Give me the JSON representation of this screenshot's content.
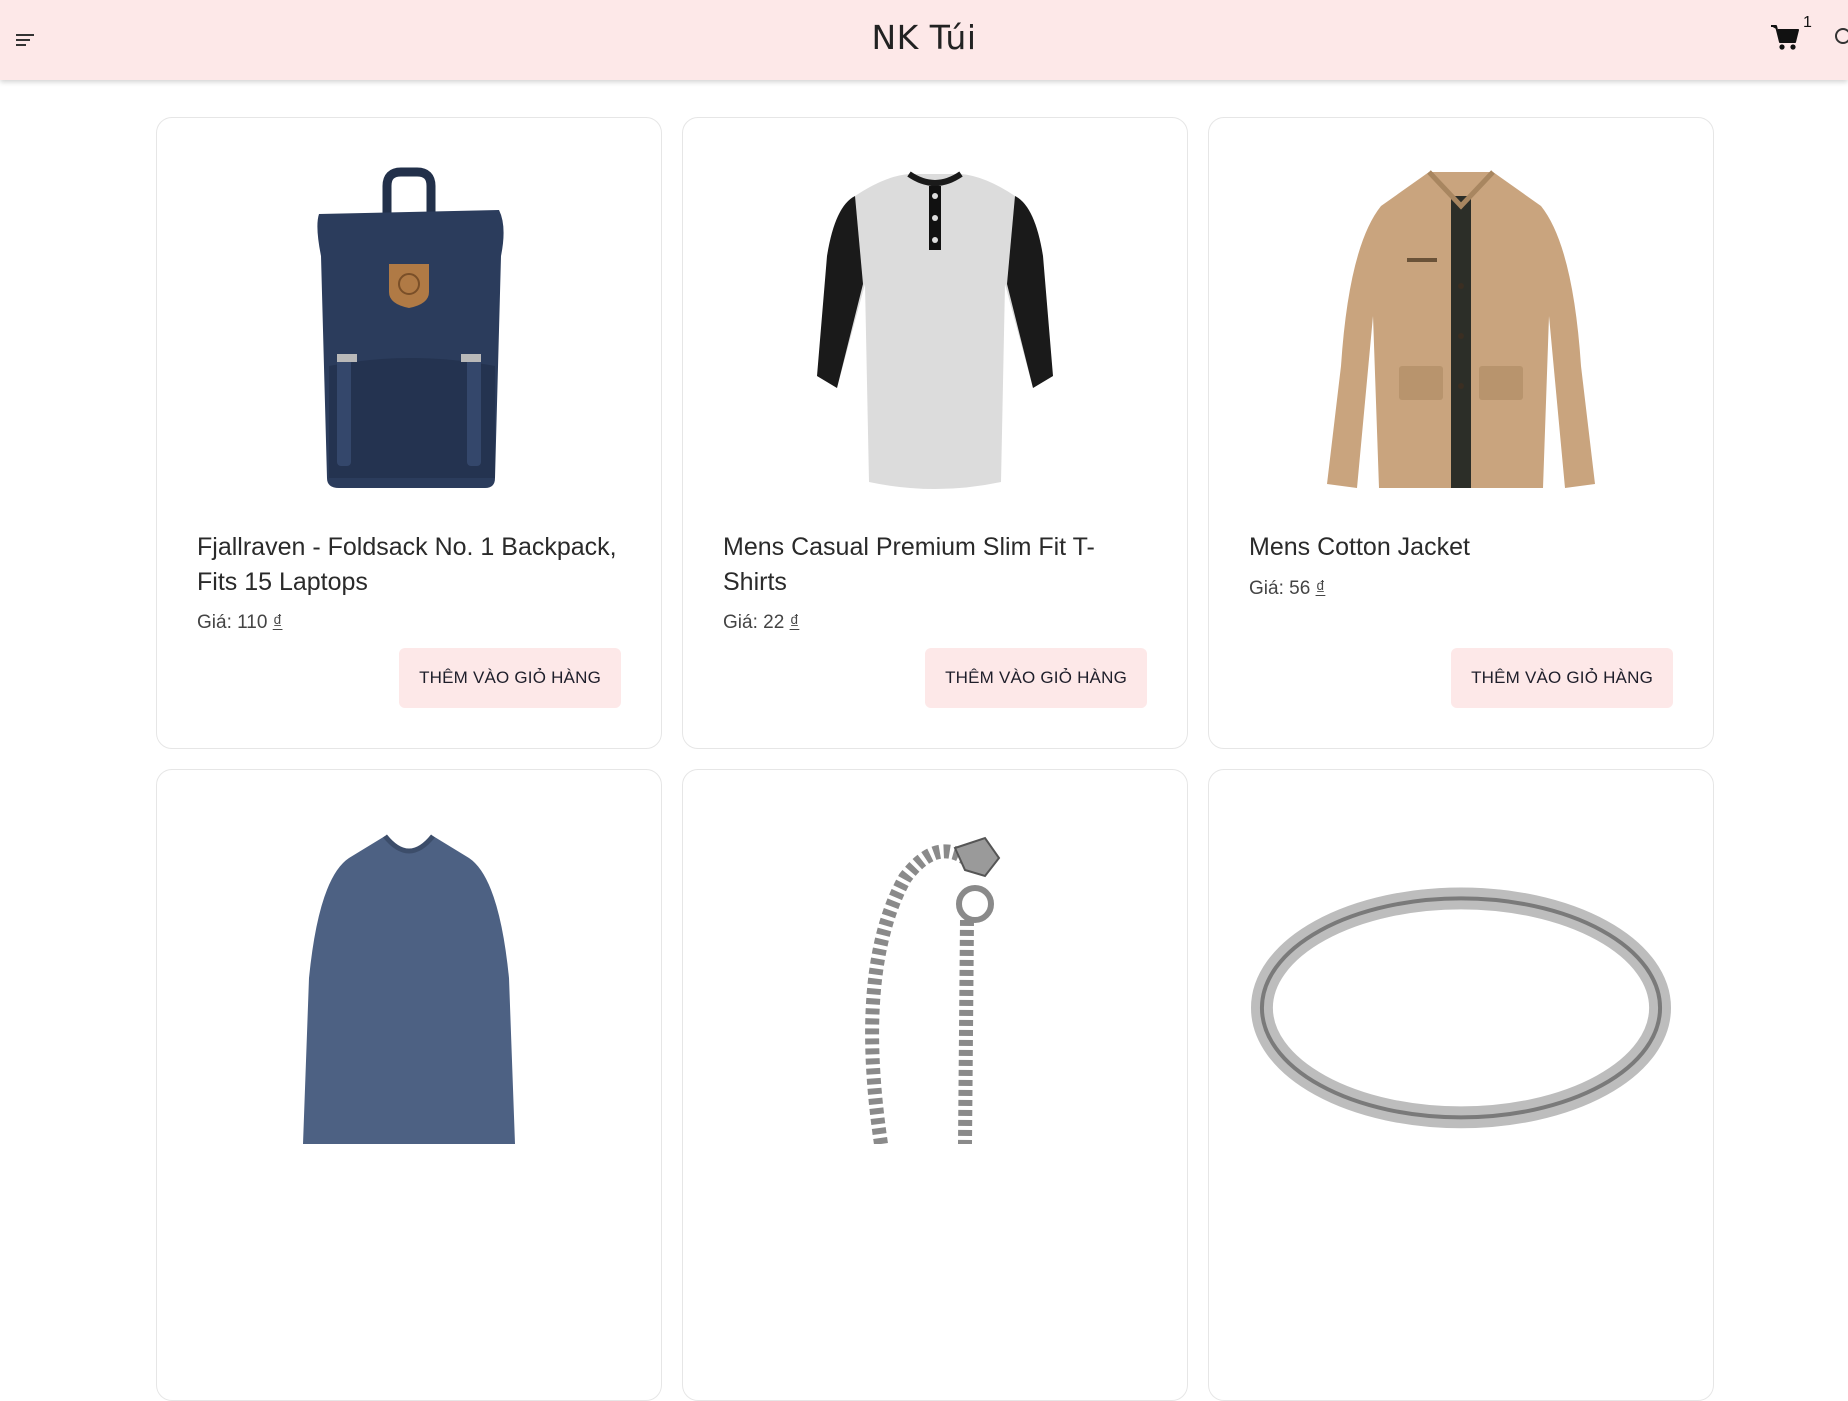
{
  "header": {
    "logo": "NK Túi",
    "cart_count": "1",
    "menu_icon": "hamburger-menu-icon",
    "cart_icon": "shopping-cart-icon",
    "search_icon": "search-icon"
  },
  "products": [
    {
      "title": "Fjallraven - Foldsack No. 1 Backpack, Fits 15 Laptops",
      "price_label": "Giá:",
      "price_value": "110",
      "currency": "₫",
      "button": "THÊM VÀO GIỎ HÀNG",
      "image": "backpack"
    },
    {
      "title": "Mens Casual Premium Slim Fit T-Shirts",
      "price_label": "Giá:",
      "price_value": "22",
      "currency": "₫",
      "button": "THÊM VÀO GIỎ HÀNG",
      "image": "raglan-tshirt"
    },
    {
      "title": "Mens Cotton Jacket",
      "price_label": "Giá:",
      "price_value": "56",
      "currency": "₫",
      "button": "THÊM VÀO GIỎ HÀNG",
      "image": "cotton-jacket"
    },
    {
      "image": "vneck-longsleeve-shirt"
    },
    {
      "image": "dragon-chain-bracelet"
    },
    {
      "image": "silver-ring"
    }
  ],
  "colors": {
    "header_bg": "#fde8e8",
    "button_bg": "#fde8e8",
    "card_border": "#e6e6e6"
  }
}
